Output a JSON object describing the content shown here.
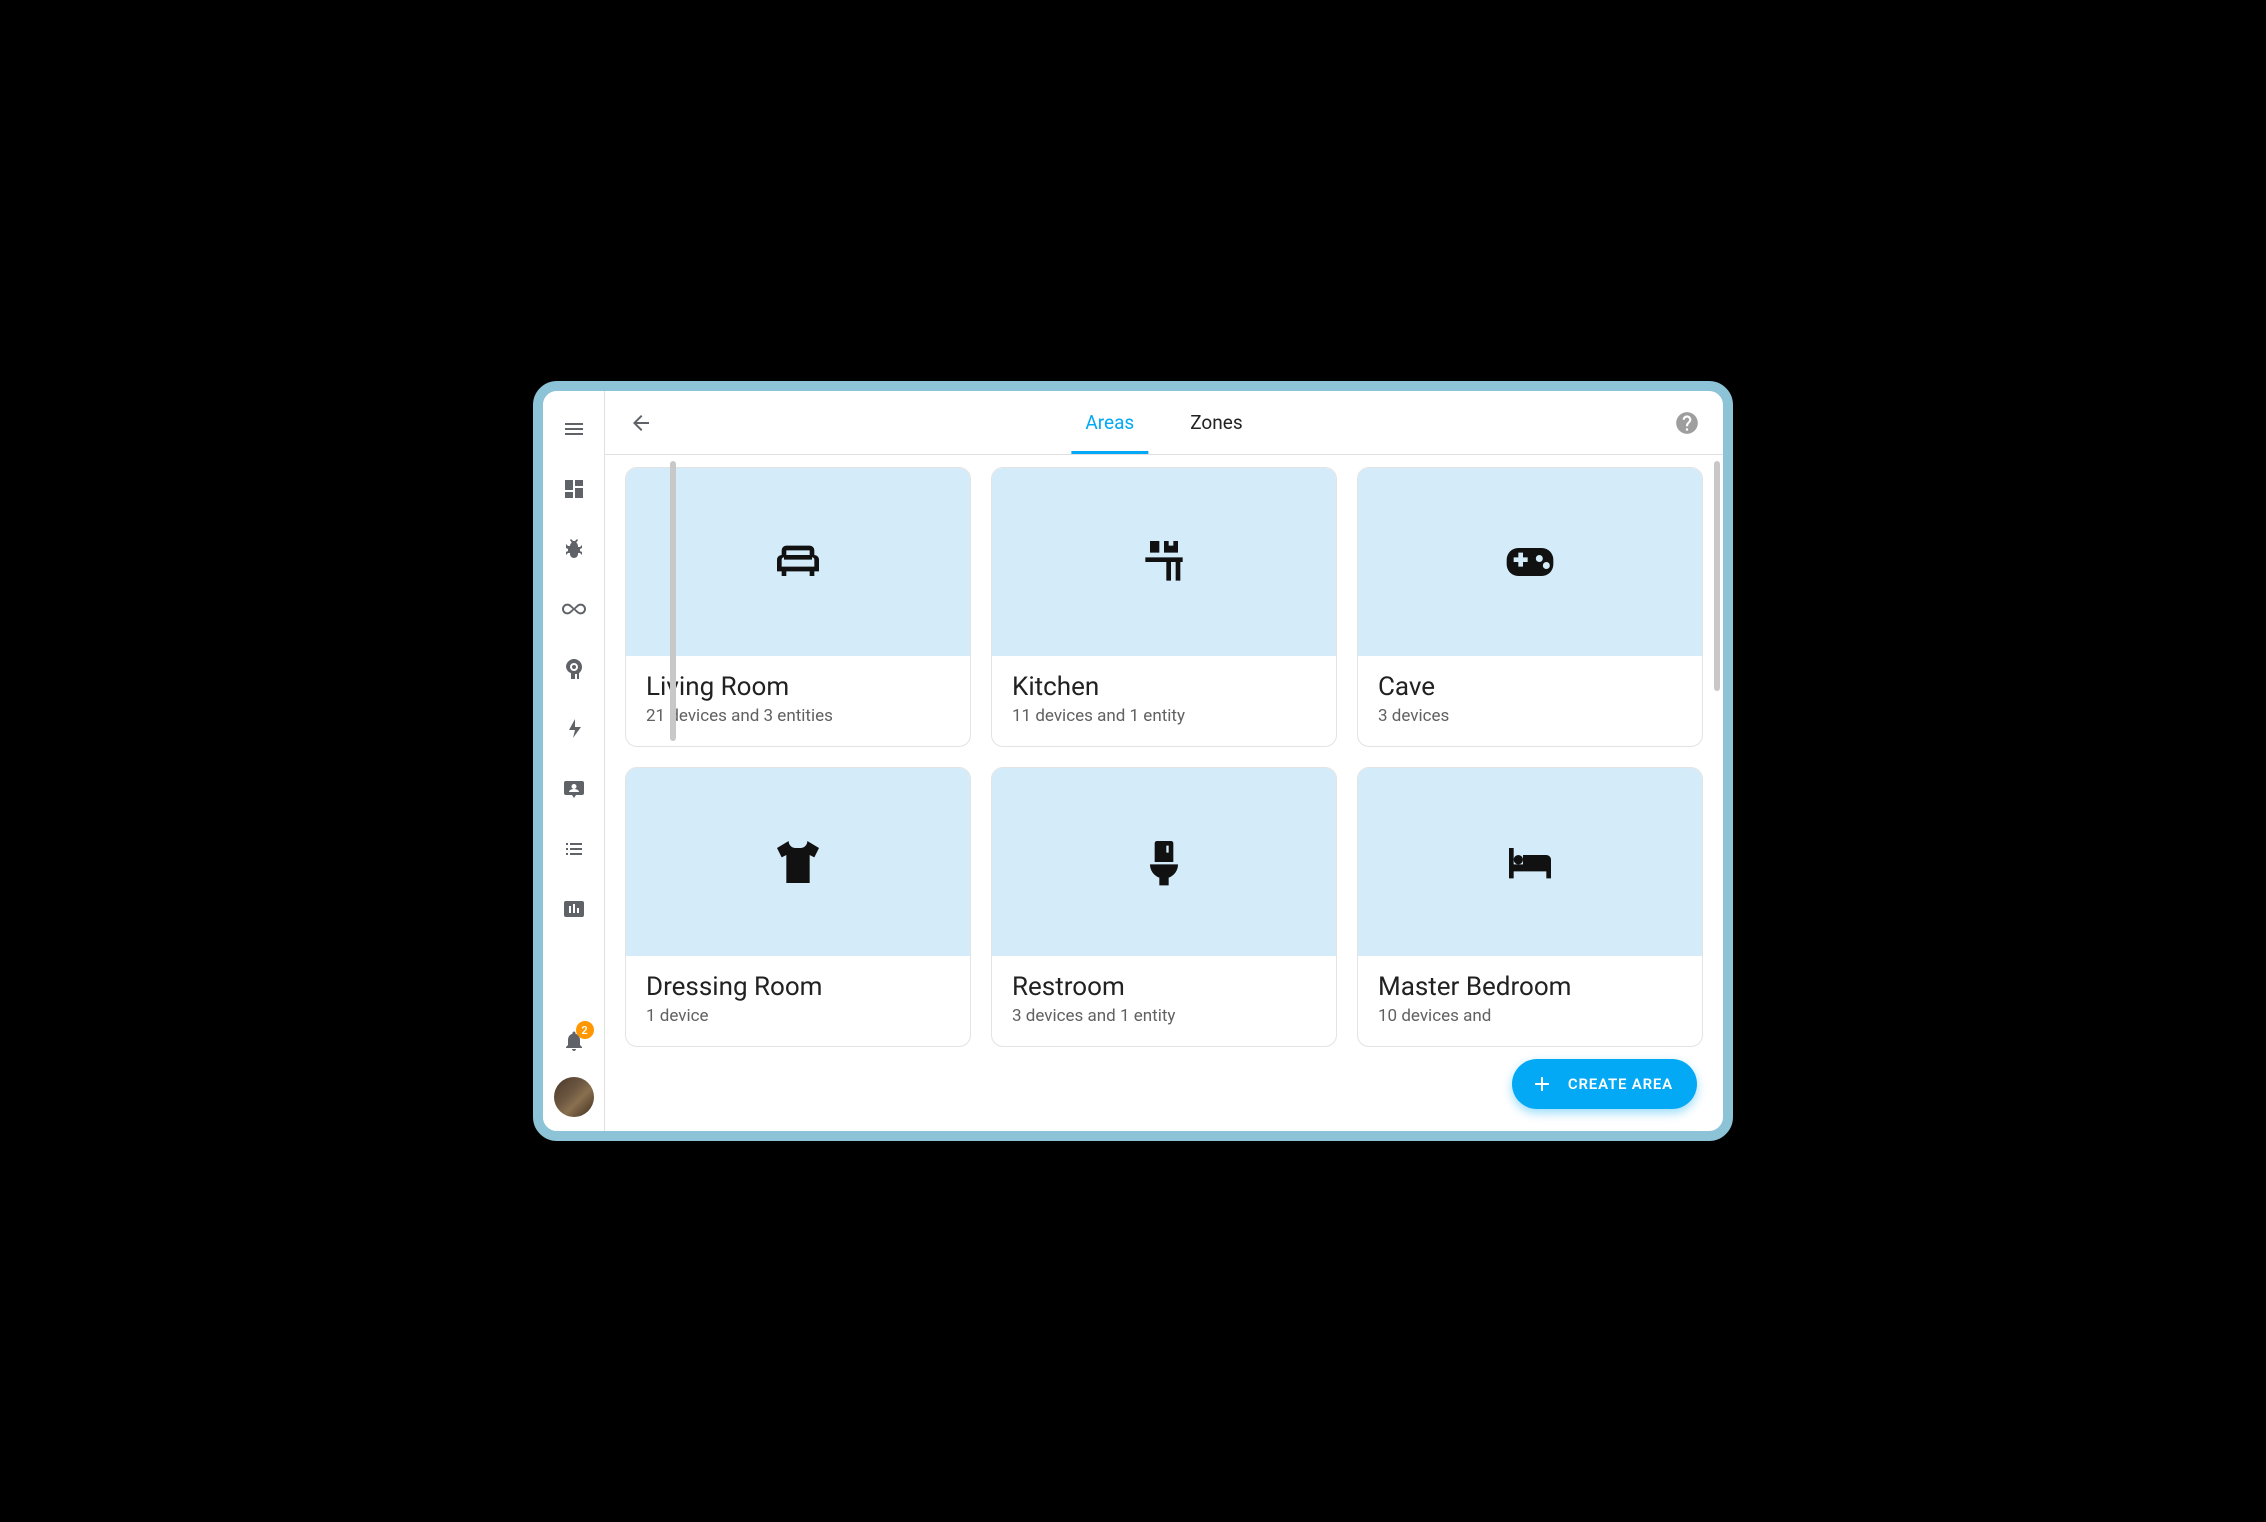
{
  "tabs": {
    "areas": "Areas",
    "zones": "Zones"
  },
  "notification_count": "2",
  "fab_label": "CREATE AREA",
  "areas": [
    {
      "title": "Living Room",
      "subtitle": "21 devices and 3 entities",
      "icon": "sofa"
    },
    {
      "title": "Kitchen",
      "subtitle": "11 devices and 1 entity",
      "icon": "kitchen"
    },
    {
      "title": "Cave",
      "subtitle": "3 devices",
      "icon": "gamepad"
    },
    {
      "title": "Dressing Room",
      "subtitle": "1 device",
      "icon": "tshirt"
    },
    {
      "title": "Restroom",
      "subtitle": "3 devices and 1 entity",
      "icon": "toilet"
    },
    {
      "title": "Master Bedroom",
      "subtitle": "10 devices and",
      "icon": "bed"
    }
  ]
}
